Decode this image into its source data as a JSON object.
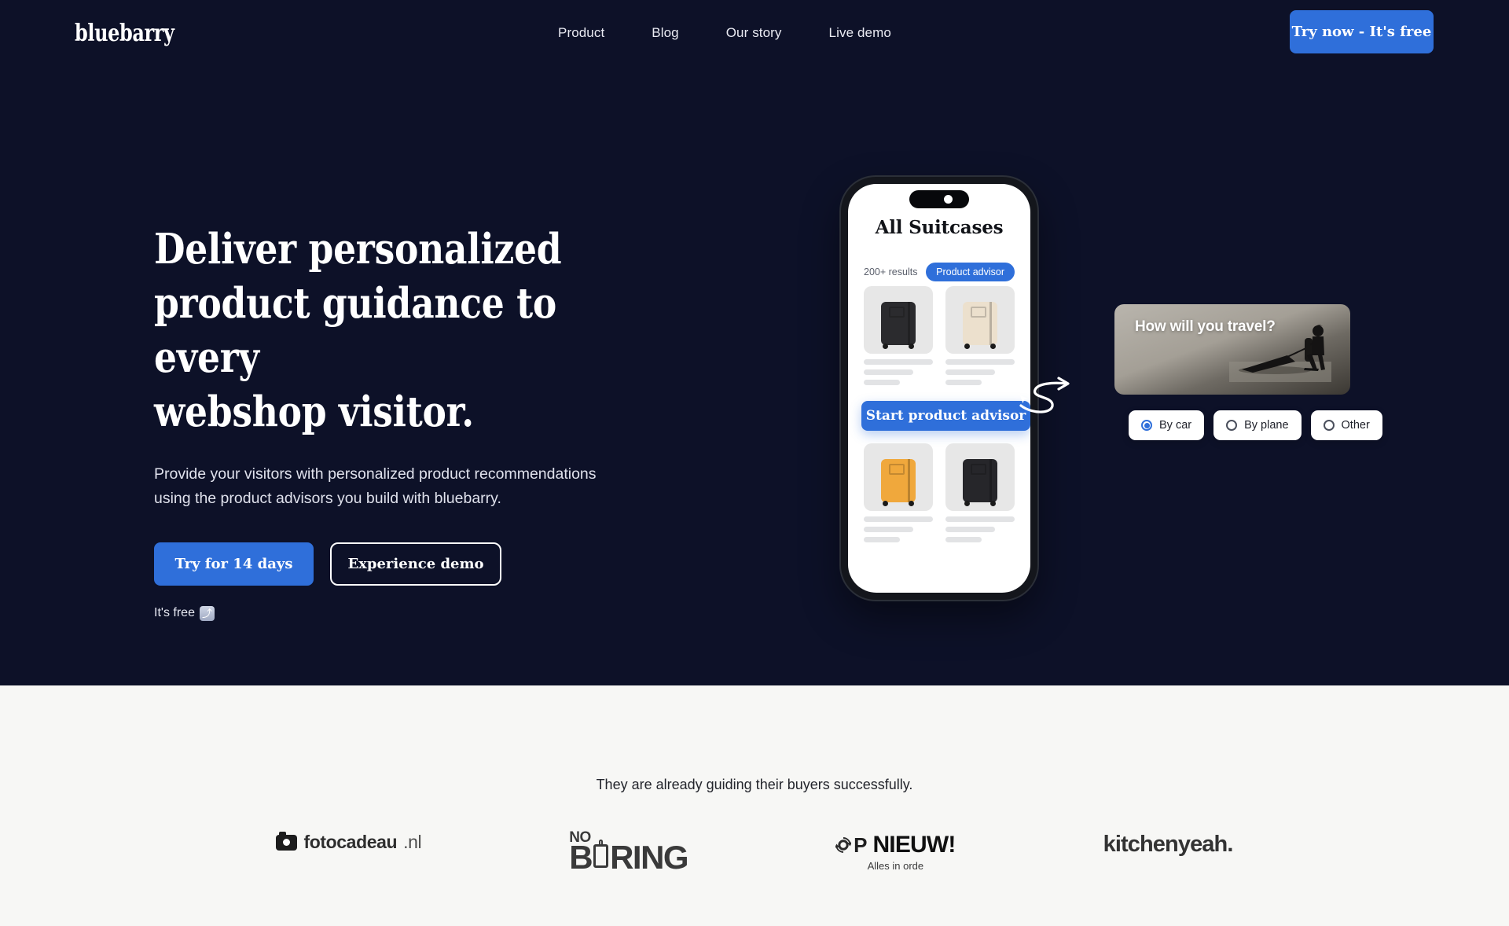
{
  "colors": {
    "hero_bg": "#0d1128",
    "section_bg": "#f7f7f5",
    "accent_blue": "#2f6fda",
    "text_light": "#ffffff"
  },
  "header": {
    "logo": "bluebarry",
    "nav": [
      {
        "label": "Product"
      },
      {
        "label": "Blog"
      },
      {
        "label": "Our story"
      },
      {
        "label": "Live demo"
      }
    ],
    "cta_label": "Try now - It's free"
  },
  "hero": {
    "headline": "Deliver personalized\nproduct guidance to every\nwebshop visitor.",
    "subhead": "Provide your visitors with personalized product recommendations\nusing the product advisors you build with bluebarry.",
    "primary_cta": "Try for 14 days",
    "secondary_cta": "Experience demo",
    "free_note": "It's free",
    "free_emoji": "⤴"
  },
  "phone": {
    "screen_title": "All Suitcases",
    "results_count": "200+ results",
    "pill_label": "Product advisor",
    "advisor_button": "Start product advisor",
    "products": [
      {
        "color": "#2b2b2e",
        "name": "suitcase-black"
      },
      {
        "color": "#ece0cd",
        "name": "suitcase-beige"
      },
      {
        "color": "#f0a83c",
        "name": "suitcase-yellow"
      },
      {
        "color": "#26262a",
        "name": "suitcase-charcoal"
      }
    ]
  },
  "travel_card": {
    "question": "How will you travel?",
    "options": [
      {
        "label": "By car",
        "selected": true
      },
      {
        "label": "By plane",
        "selected": false
      },
      {
        "label": "Other",
        "selected": false
      }
    ]
  },
  "social_proof": {
    "caption": "They are already guiding their buyers successfully.",
    "logos": [
      {
        "name": "fotocadeau",
        "text": "fotocadeau",
        "tld": ".nl"
      },
      {
        "name": "no-boring",
        "top": "NO",
        "bottom_left": "B",
        "bottom_right": "RING"
      },
      {
        "name": "op-nieuw",
        "word1": "P",
        "word2": "NIEUW!",
        "sub": "Alles in orde"
      },
      {
        "name": "kitchenyeah",
        "text": "kitchenyeah."
      }
    ]
  }
}
